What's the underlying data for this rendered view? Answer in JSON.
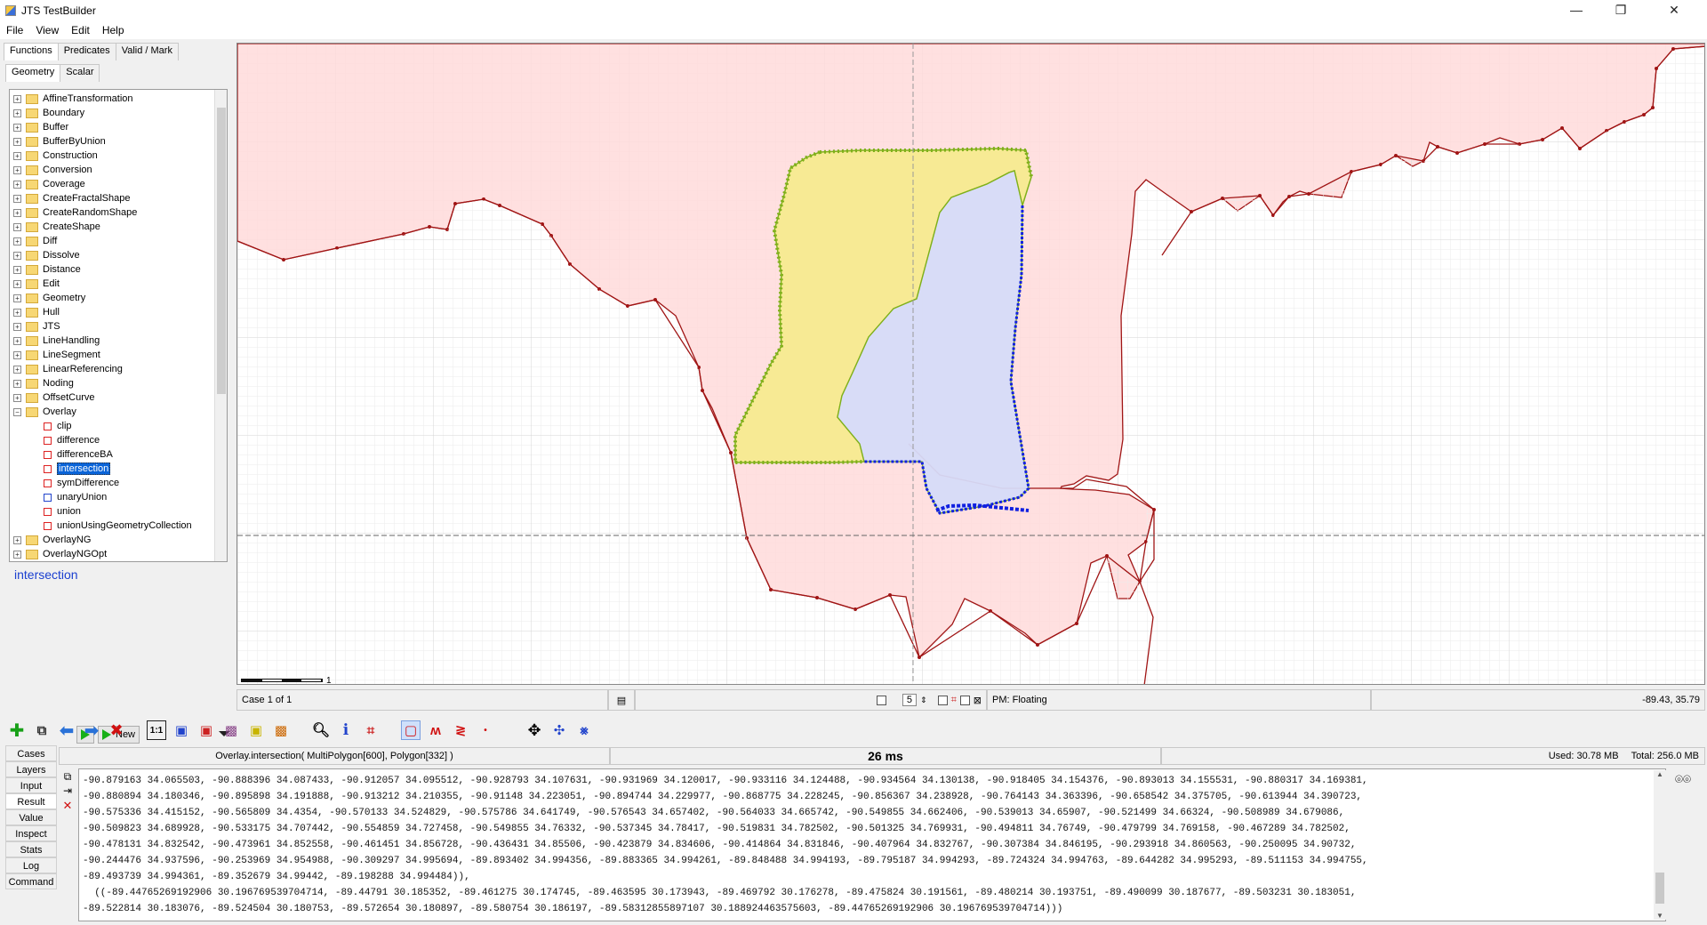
{
  "window": {
    "title": "JTS TestBuilder",
    "controls": [
      "—",
      "❐",
      "✕"
    ]
  },
  "menu": [
    "File",
    "View",
    "Edit",
    "Help"
  ],
  "panel": {
    "tabs": [
      "Functions",
      "Predicates",
      "Valid / Mark"
    ],
    "subtabs": [
      "Geometry",
      "Scalar"
    ],
    "categories": [
      "AffineTransformation",
      "Boundary",
      "Buffer",
      "BufferByUnion",
      "Construction",
      "Conversion",
      "Coverage",
      "CreateFractalShape",
      "CreateRandomShape",
      "CreateShape",
      "Diff",
      "Dissolve",
      "Distance",
      "Edit",
      "Geometry",
      "Hull",
      "JTS",
      "LineHandling",
      "LineSegment",
      "LinearReferencing",
      "Noding",
      "OffsetCurve",
      "Overlay"
    ],
    "overlay_functions": [
      "clip",
      "difference",
      "differenceBA",
      "intersection",
      "symDifference",
      "unaryUnion",
      "union",
      "unionUsingGeometryCollection"
    ],
    "after_categories": [
      "OverlayNG",
      "OverlayNGOpt"
    ],
    "selected_function": "intersection",
    "run_label": "New"
  },
  "status": {
    "case": "Case 1 of 1",
    "precision_value": "5",
    "pm": "PM: Floating",
    "coords": "-89.43, 35.79",
    "scale_label": "1"
  },
  "sidetabs": [
    "Cases",
    "Layers",
    "Input",
    "Result",
    "Value",
    "Inspect",
    "Stats",
    "Log",
    "Command"
  ],
  "result": {
    "expression": "Overlay.intersection( MultiPolygon[600], Polygon[332] )",
    "time": "26 ms",
    "memory_used": "Used: 30.78 MB",
    "memory_total": "Total: 256.0 MB",
    "lines": [
      "-90.879163 34.065503, -90.888396 34.087433, -90.912057 34.095512, -90.928793 34.107631, -90.931969 34.120017, -90.933116 34.124488, -90.934564 34.130138, -90.918405 34.154376, -90.893013 34.155531, -90.880317 34.169381,",
      "-90.880894 34.180346, -90.895898 34.191888, -90.913212 34.210355, -90.91148 34.223051, -90.894744 34.229977, -90.868775 34.228245, -90.856367 34.238928, -90.764143 34.363396, -90.658542 34.375705, -90.613944 34.390723,",
      "-90.575336 34.415152, -90.565809 34.4354, -90.570133 34.524829, -90.575786 34.641749, -90.576543 34.657402, -90.564033 34.665742, -90.549855 34.662406, -90.539013 34.65907, -90.521499 34.66324, -90.508989 34.679086,",
      "-90.509823 34.689928, -90.533175 34.707442, -90.554859 34.727458, -90.549855 34.76332, -90.537345 34.78417, -90.519831 34.782502, -90.501325 34.769931, -90.494811 34.76749, -90.479799 34.769158, -90.467289 34.782502,",
      "-90.478131 34.832542, -90.473961 34.852558, -90.461451 34.856728, -90.436431 34.85506, -90.423879 34.834606, -90.414864 34.831846, -90.407964 34.832767, -90.307384 34.846195, -90.293918 34.860563, -90.250095 34.90732,",
      "-90.244476 34.937596, -90.253969 34.954988, -90.309297 34.995694, -89.893402 34.994356, -89.883365 34.994261, -89.848488 34.994193, -89.795187 34.994293, -89.724324 34.994763, -89.644282 34.995293, -89.511153 34.994755,",
      "-89.493739 34.994361, -89.352679 34.99442, -89.198288 34.994484)),",
      "  ((-89.44765269192906 30.196769539704714, -89.44791 30.185352, -89.461275 30.174745, -89.463595 30.173943, -89.469792 30.176278, -89.475824 30.191561, -89.480214 30.193751, -89.490099 30.187677, -89.503231 30.183051,",
      "-89.522814 30.183076, -89.524504 30.180753, -89.572654 30.180897, -89.580754 30.186197, -89.58312855897107 30.188924463575603, -89.44765269192906 30.196769539704714)))"
    ]
  },
  "colors": {
    "polygon_a": "#ffdddd",
    "polygon_a_edge": "#a01515",
    "polygon_b": "#f8ec9a",
    "polygon_b_edge": "#7fb01a",
    "result": "#d8dcfa",
    "result_edge": "#1020e0"
  }
}
